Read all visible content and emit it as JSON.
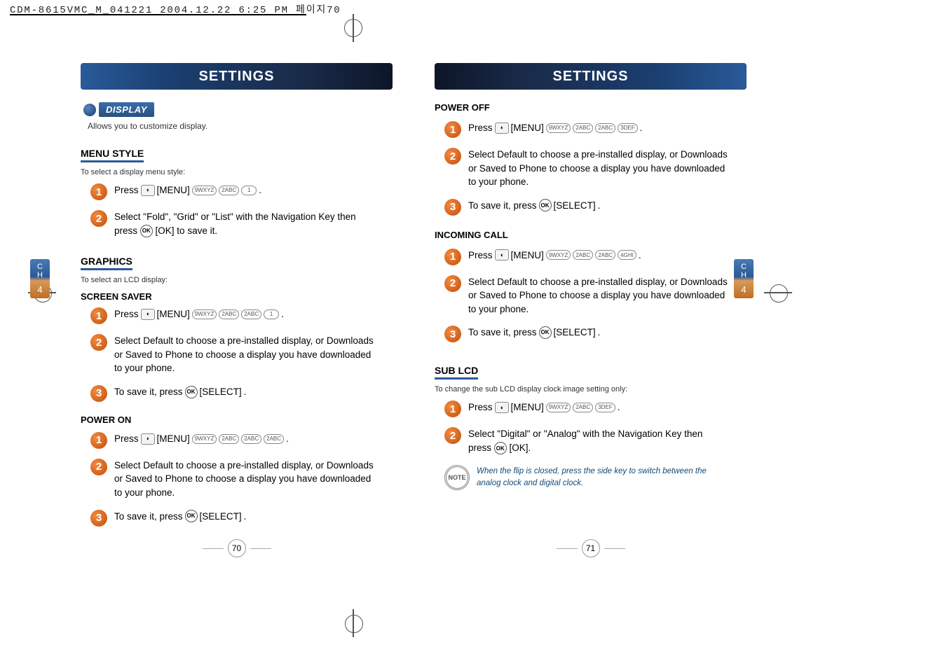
{
  "doc_mark": "CDM-8615VMC_M_041221  2004.12.22 6:25 PM  페이지70",
  "page_left_num": "70",
  "page_right_num": "71",
  "ch_tab": {
    "top": "C\nH",
    "bot": "4"
  },
  "title": "SETTINGS",
  "badge": {
    "label": "DISPLAY"
  },
  "intro": "Allows you to customize display.",
  "note_label": "NOTE",
  "labels": {
    "menu": "[MENU]",
    "ok": "[OK]",
    "select": "[SELECT]",
    "press": "Press",
    "to_save": "To save it, press"
  },
  "icons": {
    "ok": "OK",
    "soft": "◖"
  },
  "sections": {
    "menu_style": {
      "head": "MENU STYLE",
      "sub": "To select a display menu style:",
      "s1_keys": [
        "9WXYZ",
        "2ABC",
        "1"
      ],
      "s2": "Select \"Fold\", \"Grid\" or \"List\" with the Navigation Key then press",
      "s2_end": "[OK] to save it."
    },
    "graphics": {
      "head": "GRAPHICS",
      "sub": "To select an LCD display:"
    },
    "screen_saver": {
      "head": "SCREEN SAVER",
      "s1_keys": [
        "9WXYZ",
        "2ABC",
        "2ABC",
        "1"
      ],
      "s2": "Select Default to choose a pre-installed display, or Downloads or Saved to Phone to choose a display you have downloaded to your phone."
    },
    "power_on": {
      "head": "POWER ON",
      "s1_keys": [
        "9WXYZ",
        "2ABC",
        "2ABC",
        "2ABC"
      ],
      "s2": "Select Default to choose a pre-installed display, or Downloads or Saved to Phone to choose a display you have downloaded to your phone."
    },
    "power_off": {
      "head": "POWER OFF",
      "s1_keys": [
        "9WXYZ",
        "2ABC",
        "2ABC",
        "3DEF"
      ],
      "s2": "Select Default to choose a pre-installed display, or Downloads or Saved to Phone to choose a display you have downloaded to your phone."
    },
    "incoming": {
      "head": "INCOMING CALL",
      "s1_keys": [
        "9WXYZ",
        "2ABC",
        "2ABC",
        "4GHI"
      ],
      "s2": "Select Default to choose a pre-installed display, or Downloads or Saved to Phone to choose a display you have downloaded to your phone."
    },
    "sub_lcd": {
      "head": "SUB LCD",
      "sub": "To change the sub LCD display clock image setting only:",
      "s1_keys": [
        "9WXYZ",
        "2ABC",
        "3DEF"
      ],
      "s2": "Select \"Digital\" or \"Analog\" with the Navigation Key then press",
      "s2_end": "[OK].",
      "note": "When the flip is closed, press the side key to switch between the analog clock and digital clock."
    }
  }
}
